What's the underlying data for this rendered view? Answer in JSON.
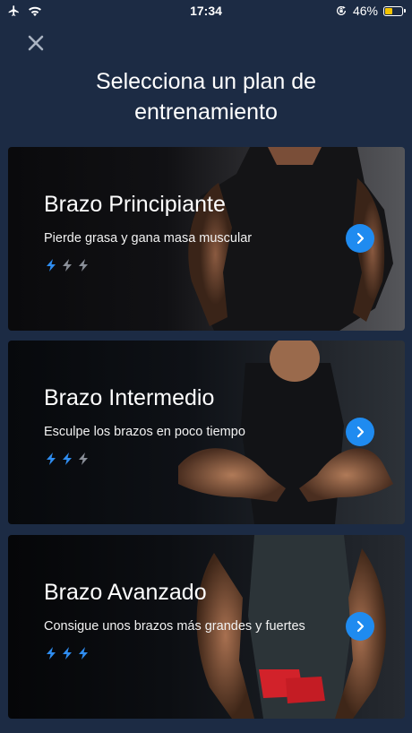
{
  "status_bar": {
    "time": "17:34",
    "battery_percent": "46%",
    "battery_level": 0.46,
    "icons": [
      "airplane-icon",
      "wifi-icon",
      "orientation-lock-icon",
      "battery-icon"
    ]
  },
  "header": {
    "close_icon": "close-icon",
    "title": "Selecciona un plan de entrenamiento"
  },
  "colors": {
    "background": "#1c2b44",
    "accent_blue": "#1f8bf0",
    "bolt_active": "#2f8df0",
    "bolt_inactive": "#8a8f98"
  },
  "plans": [
    {
      "title": "Brazo Principiante",
      "subtitle": "Pierde grasa y gana masa muscular",
      "level": 1,
      "max_level": 3
    },
    {
      "title": "Brazo Intermedio",
      "subtitle": "Esculpe los brazos en poco tiempo",
      "level": 2,
      "max_level": 3
    },
    {
      "title": "Brazo Avanzado",
      "subtitle": "Consigue unos brazos más grandes y fuertes",
      "level": 3,
      "max_level": 3
    }
  ]
}
